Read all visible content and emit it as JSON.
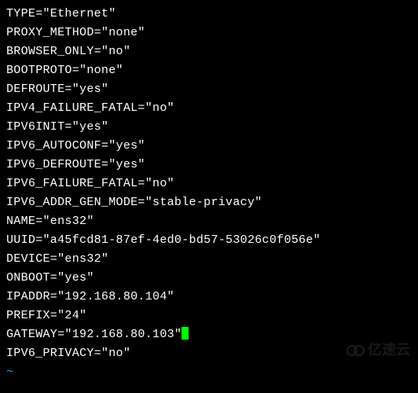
{
  "config": {
    "lines": [
      {
        "key": "TYPE",
        "value": "Ethernet"
      },
      {
        "key": "PROXY_METHOD",
        "value": "none"
      },
      {
        "key": "BROWSER_ONLY",
        "value": "no"
      },
      {
        "key": "BOOTPROTO",
        "value": "none"
      },
      {
        "key": "DEFROUTE",
        "value": "yes"
      },
      {
        "key": "IPV4_FAILURE_FATAL",
        "value": "no"
      },
      {
        "key": "IPV6INIT",
        "value": "yes"
      },
      {
        "key": "IPV6_AUTOCONF",
        "value": "yes"
      },
      {
        "key": "IPV6_DEFROUTE",
        "value": "yes"
      },
      {
        "key": "IPV6_FAILURE_FATAL",
        "value": "no"
      },
      {
        "key": "IPV6_ADDR_GEN_MODE",
        "value": "stable-privacy"
      },
      {
        "key": "NAME",
        "value": "ens32"
      },
      {
        "key": "UUID",
        "value": "a45fcd81-87ef-4ed0-bd57-53026c0f056e"
      },
      {
        "key": "DEVICE",
        "value": "ens32"
      },
      {
        "key": "ONBOOT",
        "value": "yes"
      },
      {
        "key": "IPADDR",
        "value": "192.168.80.104"
      },
      {
        "key": "PREFIX",
        "value": "24"
      },
      {
        "key": "GATEWAY",
        "value": "192.168.80.103",
        "cursor": true
      },
      {
        "key": "IPV6_PRIVACY",
        "value": "no"
      }
    ],
    "tilde": "~"
  },
  "watermark": {
    "text": "亿速云"
  }
}
